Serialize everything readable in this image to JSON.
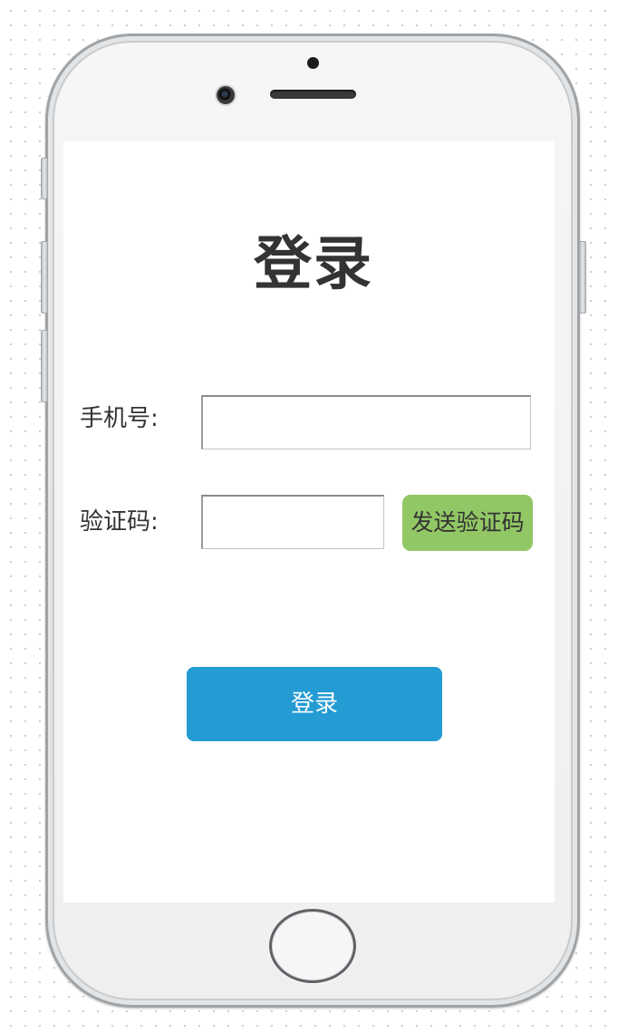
{
  "page": {
    "title": "登录"
  },
  "form": {
    "phone_label": "手机号:",
    "phone_value": "",
    "code_label": "验证码:",
    "code_value": "",
    "send_code_label": "发送验证码",
    "login_label": "登录"
  },
  "colors": {
    "send_code_bg": "#92c765",
    "login_bg": "#249bd3",
    "text": "#333333"
  },
  "icons": {
    "camera": "front-camera-icon",
    "speaker": "earpiece-speaker-icon",
    "sensor": "proximity-sensor-icon",
    "home": "home-button-icon"
  }
}
